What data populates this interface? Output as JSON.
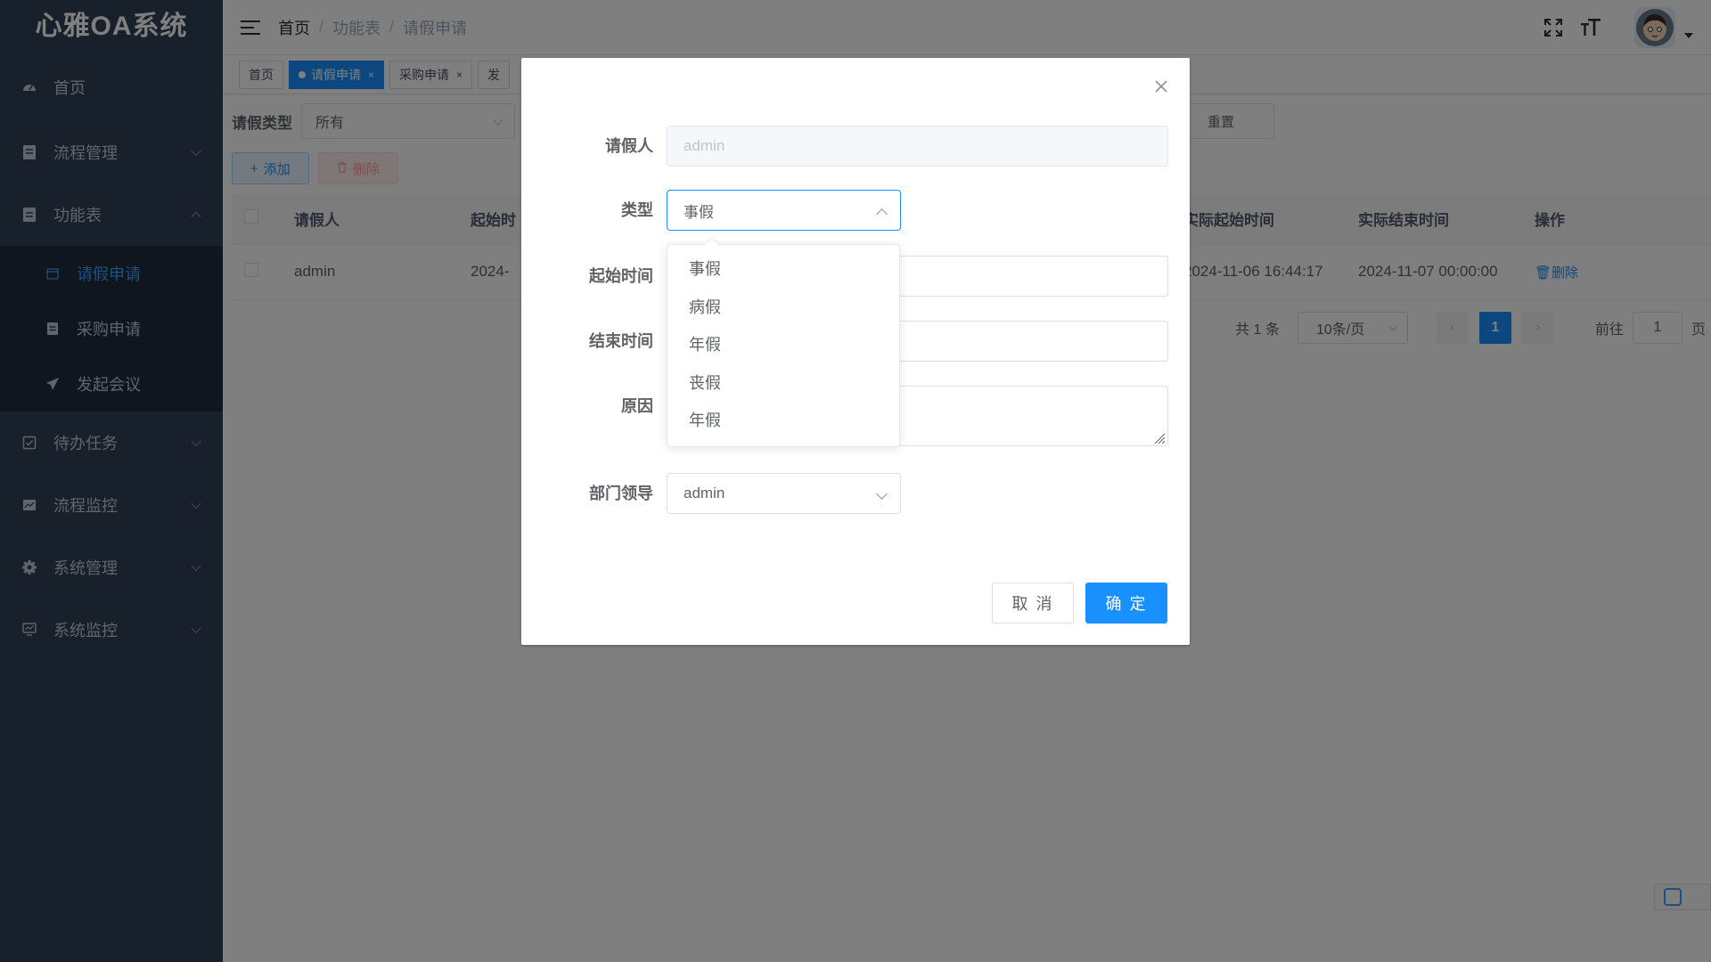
{
  "app": {
    "title": "心雅OA系统"
  },
  "sidebar": {
    "items": [
      {
        "label": "首页",
        "icon": "dashboard-icon"
      },
      {
        "label": "流程管理",
        "icon": "document-icon"
      },
      {
        "label": "功能表",
        "icon": "table-icon"
      },
      {
        "label": "待办任务",
        "icon": "checkbox-icon"
      },
      {
        "label": "流程监控",
        "icon": "monitor-icon"
      },
      {
        "label": "系统管理",
        "icon": "gear-icon"
      },
      {
        "label": "系统监控",
        "icon": "screen-icon"
      }
    ],
    "submenu": [
      {
        "label": "请假申请",
        "icon": "calendar-icon"
      },
      {
        "label": "采购申请",
        "icon": "document-icon"
      },
      {
        "label": "发起会议",
        "icon": "send-icon"
      }
    ]
  },
  "header": {
    "breadcrumb": [
      "首页",
      "功能表",
      "请假申请"
    ]
  },
  "tags": [
    {
      "label": "首页"
    },
    {
      "label": "请假申请"
    },
    {
      "label": "采购申请"
    },
    {
      "label": "发"
    }
  ],
  "search": {
    "label": "请假类型",
    "value": "所有",
    "reset_label": "重置"
  },
  "toolbar": {
    "add_label": "添加",
    "delete_label": "删除"
  },
  "table": {
    "headers": [
      "请假人",
      "起始时",
      "实际起始时间",
      "实际结束时间",
      "操作"
    ],
    "rows": [
      {
        "applicant": "admin",
        "start": "2024-",
        "actual_start": "2024-11-06 16:44:17",
        "actual_end": "2024-11-07 00:00:00",
        "op": "删除"
      }
    ]
  },
  "pagination": {
    "total": "共 1 条",
    "page_size": "10条/页",
    "current_page": "1",
    "goto_label": "前往",
    "goto_value": "1",
    "page_unit": "页"
  },
  "dialog": {
    "fields": {
      "applicant": {
        "label": "请假人",
        "placeholder": "admin"
      },
      "type": {
        "label": "类型",
        "value": "事假"
      },
      "start": {
        "label": "起始时间"
      },
      "end": {
        "label": "结束时间"
      },
      "reason": {
        "label": "原因"
      },
      "leader": {
        "label": "部门领导",
        "value": "admin"
      }
    },
    "type_options": [
      "事假",
      "病假",
      "年假",
      "丧假",
      "年假"
    ],
    "cancel_label": "取 消",
    "ok_label": "确 定"
  },
  "colors": {
    "sidebar_bg": "#304156",
    "primary": "#1890ff",
    "sidebar_active": "#409eff"
  }
}
